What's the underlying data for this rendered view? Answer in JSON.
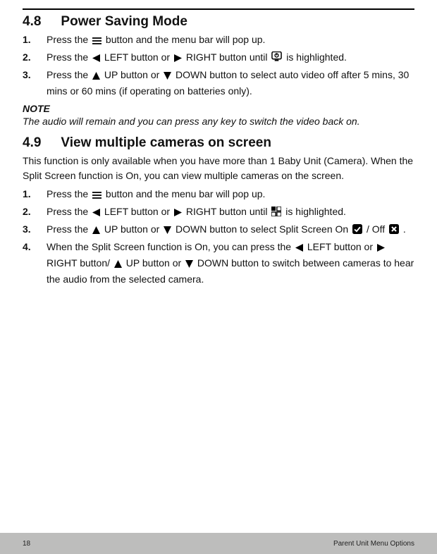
{
  "section48": {
    "number": "4.8",
    "title": "Power Saving Mode",
    "steps": {
      "s1a": "Press the ",
      "s1b": " button and the menu bar will pop up.",
      "s2a": "Press the ",
      "s2b": " LEFT button or ",
      "s2c": " RIGHT button until  ",
      "s2d": "  is highlighted.",
      "s3a": "Press the ",
      "s3b": " UP button or ",
      "s3c": " DOWN button to select auto video off after 5 mins, 30 mins or 60 mins (if operating on batteries only)."
    },
    "noteHead": "NOTE",
    "noteBody": "The audio will remain and you can press any key to switch the video back on."
  },
  "section49": {
    "number": "4.9",
    "title": "View multiple cameras on screen",
    "intro": "This function is only available when you have more than 1 Baby Unit (Camera). When the Split Screen function is On, you can view multiple cameras on the screen.",
    "steps": {
      "s1a": "Press the ",
      "s1b": " button and the menu bar will pop up.",
      "s2a": "Press the ",
      "s2b": " LEFT button or ",
      "s2c": " RIGHT button until  ",
      "s2d": " is highlighted.",
      "s3a": "Press the ",
      "s3b": " UP button or ",
      "s3c": " DOWN button to select Split Screen On  ",
      "s3d": "  / Off  ",
      "s3e": " .",
      "s4a": "When the Split Screen function is On, you can press the ",
      "s4b": " LEFT button or ",
      "s4c": " RIGHT button/ ",
      "s4d": " UP button or ",
      "s4e": " DOWN button to switch between cameras to hear the audio from the selected camera."
    }
  },
  "footer": {
    "page": "18",
    "label": "Parent Unit Menu Options"
  }
}
